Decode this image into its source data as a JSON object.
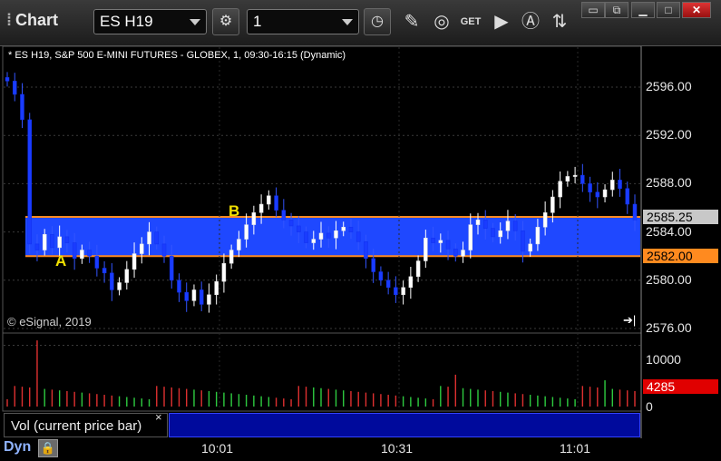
{
  "window": {
    "title": "Chart",
    "symbol_value": "ES H19",
    "interval_value": "1",
    "toolbar_icons": [
      "settings-gear-icon",
      "clock-icon",
      "pencil-icon",
      "study-icon",
      "get-icon",
      "play-icon",
      "annotation-icon",
      "link-icon"
    ],
    "window_buttons": [
      "restore-icon",
      "tile-icon",
      "minimize-icon",
      "maximize-icon",
      "close-icon"
    ]
  },
  "chart": {
    "header": "* ES H19, S&P 500 E-MINI FUTURES - GLOBEX, 1, 09:30-16:15 (Dynamic)",
    "copyright": "© eSignal, 2019",
    "price_ticks": [
      "2596.00",
      "2592.00",
      "2588.00",
      "2584.00",
      "2580.00",
      "2576.00"
    ],
    "price_tick_values": [
      2596,
      2592,
      2588,
      2584,
      2580,
      2576
    ],
    "current_price": "2585.25",
    "level_price": "2582.00",
    "marker_a": "A",
    "marker_b": "B",
    "time_labels": [
      "10:01",
      "10:31",
      "11:01"
    ],
    "colors": {
      "up_candle": "#ffffff",
      "down_candle": "#1a3cff",
      "band": "#1f48ff",
      "band_edge": "#ff8a1f",
      "current_tag": "#c8c8c8",
      "level_tag": "#ff8a1f"
    }
  },
  "chart_data": {
    "type": "candlestick",
    "title": "ES H19, S&P 500 E-MINI FUTURES - GLOBEX, 1, 09:30-16:15 (Dynamic)",
    "ylim": [
      2576,
      2598
    ],
    "band": [
      2582.0,
      2585.25
    ],
    "closes": [
      2596.5,
      2595.4,
      2593.3,
      2583.0,
      2582.5,
      2583.8,
      2582.7,
      2583.6,
      2583.1,
      2581.8,
      2582.5,
      2582.0,
      2581.0,
      2580.6,
      2579.2,
      2579.8,
      2580.9,
      2582.2,
      2583.0,
      2584.0,
      2583.0,
      2582.0,
      2580.0,
      2579.0,
      2578.3,
      2579.2,
      2578.0,
      2578.8,
      2579.9,
      2581.4,
      2582.5,
      2583.4,
      2584.6,
      2585.6,
      2586.3,
      2587.0,
      2585.8,
      2585.0,
      2584.5,
      2584.0,
      2583.1,
      2583.4,
      2583.9,
      2583.5,
      2584.1,
      2584.4,
      2584.0,
      2583.2,
      2581.8,
      2580.7,
      2580.0,
      2579.4,
      2578.8,
      2579.4,
      2580.3,
      2581.6,
      2583.5,
      2583.1,
      2583.3,
      2582.6,
      2582.0,
      2582.5,
      2584.6,
      2585.0,
      2584.3,
      2583.6,
      2584.1,
      2584.9,
      2584.1,
      2582.4,
      2583.0,
      2584.4,
      2585.6,
      2586.9,
      2588.2,
      2588.6,
      2588.7,
      2588.0,
      2587.3,
      2586.9,
      2587.5,
      2588.3,
      2587.6,
      2586.3,
      2585.0
    ],
    "volume_ylim": [
      0,
      12000
    ],
    "volume_ticks": [
      "10000",
      "0"
    ],
    "current_volume": "4285",
    "volume_hint": "bars mostly 1000-3000, spike ~11000 near start"
  },
  "volume_panel": {
    "label": "Vol (current price bar)",
    "close_glyph": "×",
    "y_ticks": [
      "10000",
      "0"
    ],
    "current_value": "4285"
  },
  "footer": {
    "mode": "Dyn",
    "lock_icon": "lock-icon"
  }
}
